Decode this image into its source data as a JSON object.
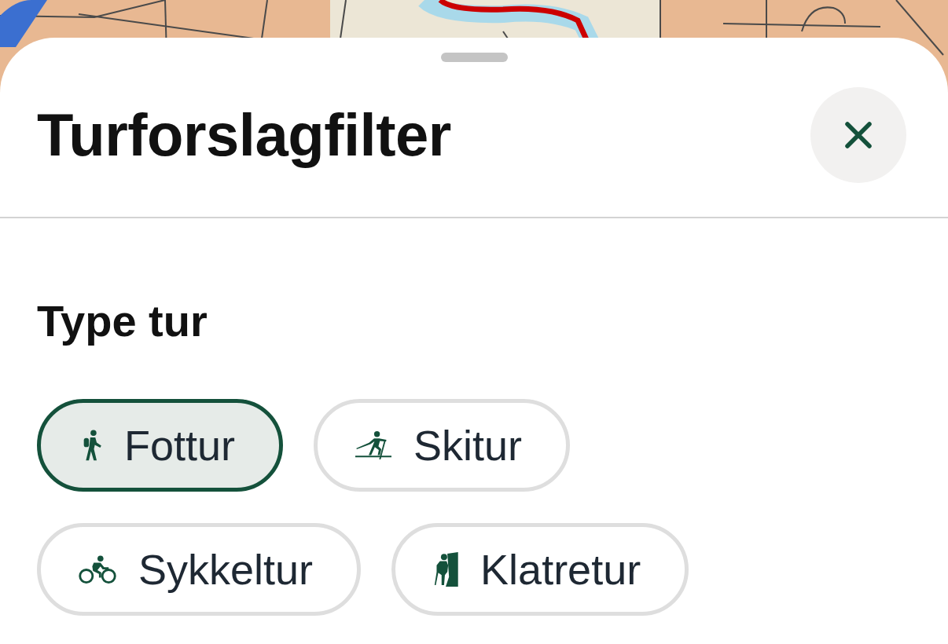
{
  "title": "Turforslagfilter",
  "sections": [
    {
      "heading": "Type tur",
      "chips": [
        {
          "label": "Fottur",
          "kind": "hike",
          "selected": true
        },
        {
          "label": "Skitur",
          "kind": "ski",
          "selected": false
        },
        {
          "label": "Sykkeltur",
          "kind": "bike",
          "selected": false
        },
        {
          "label": "Klatretur",
          "kind": "climb",
          "selected": false
        }
      ]
    }
  ]
}
